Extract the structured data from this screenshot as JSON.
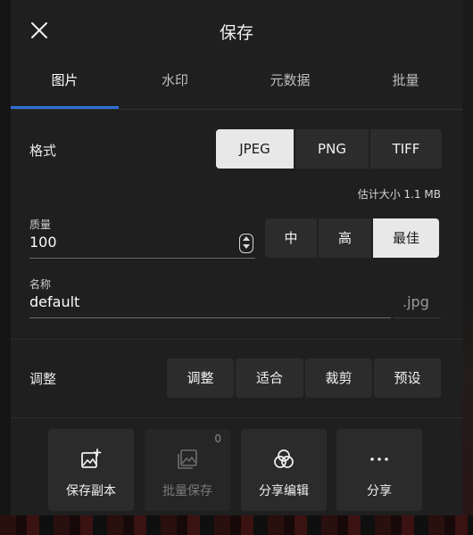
{
  "header": {
    "title": "保存"
  },
  "tabs": [
    {
      "label": "图片"
    },
    {
      "label": "水印"
    },
    {
      "label": "元数据"
    },
    {
      "label": "批量"
    }
  ],
  "format": {
    "label": "格式",
    "options": [
      "JPEG",
      "PNG",
      "TIFF"
    ],
    "selected": "JPEG"
  },
  "estimated_size": "估计大小 1.1 MB",
  "quality": {
    "label": "质量",
    "value": "100",
    "options": [
      "中",
      "高",
      "最佳"
    ],
    "selected": "最佳"
  },
  "name": {
    "label": "名称",
    "value": "default",
    "extension": ".jpg"
  },
  "adjust": {
    "label": "调整",
    "buttons": [
      "调整",
      "适合",
      "裁剪",
      "预设"
    ]
  },
  "actions": [
    {
      "label": "保存副本",
      "icon": "image-plus-icon",
      "enabled": true
    },
    {
      "label": "批量保存",
      "icon": "image-stack-icon",
      "enabled": false,
      "count": "0"
    },
    {
      "label": "分享编辑",
      "icon": "overlap-circles-icon",
      "enabled": true
    },
    {
      "label": "分享",
      "icon": "more-dots-icon",
      "enabled": true
    }
  ],
  "colors": {
    "accent": "#2f6fd6",
    "selected_bg": "#e8e8e8",
    "panel_bg": "#1f1f1f"
  }
}
